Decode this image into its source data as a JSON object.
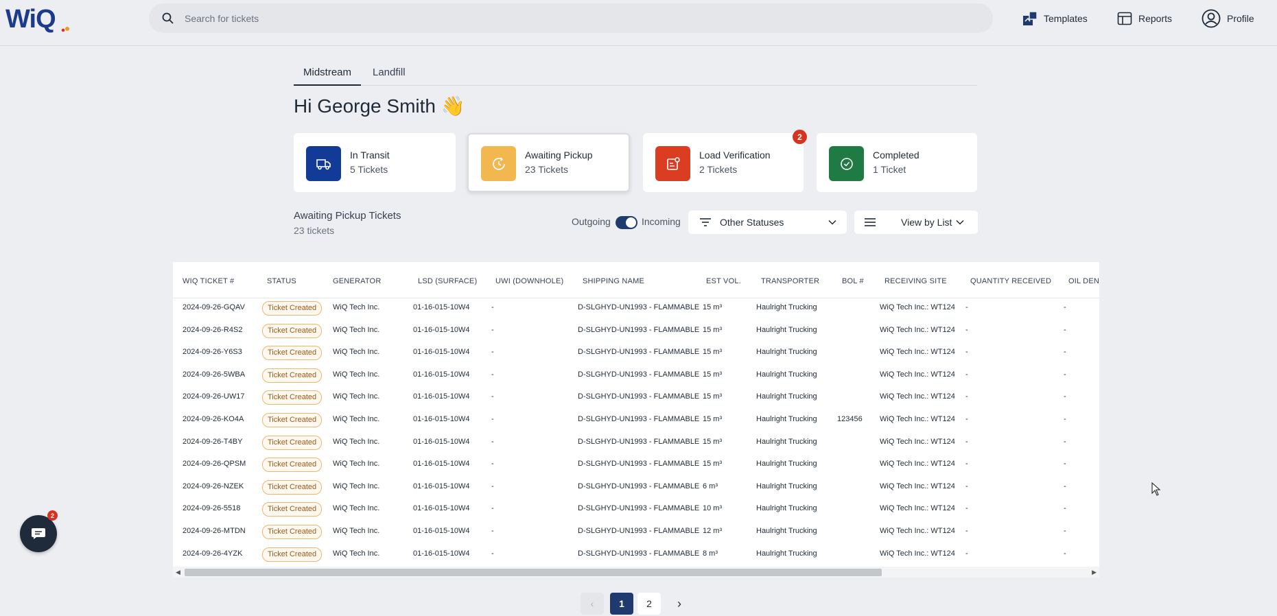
{
  "app": {
    "logo_text": "WiQ"
  },
  "header": {
    "search_placeholder": "Search for tickets",
    "nav": [
      {
        "label": "Templates",
        "icon": "templates-icon"
      },
      {
        "label": "Reports",
        "icon": "reports-icon"
      },
      {
        "label": "Profile",
        "icon": "profile-icon"
      }
    ]
  },
  "tabs": [
    {
      "label": "Midstream",
      "active": true
    },
    {
      "label": "Landfill",
      "active": false
    }
  ],
  "greeting": "Hi George Smith 👋",
  "cards": [
    {
      "title": "In Transit",
      "count": "5 Tickets",
      "color": "#123a97",
      "icon": "truck-icon"
    },
    {
      "title": "Awaiting Pickup",
      "count": "23 Tickets",
      "color": "#f2b74f",
      "icon": "clock-icon",
      "selected": true
    },
    {
      "title": "Load Verification",
      "count": "2 Tickets",
      "color": "#db3d22",
      "icon": "document-check-icon",
      "badge": "2"
    },
    {
      "title": "Completed",
      "count": "1 Ticket",
      "color": "#1f7a43",
      "icon": "check-circle-icon"
    }
  ],
  "section": {
    "title": "Awaiting Pickup Tickets",
    "subtitle": "23 tickets",
    "toggle_left": "Outgoing",
    "toggle_right": "Incoming",
    "status_filter": "Other Statuses",
    "view_mode": "View by List"
  },
  "table": {
    "columns": [
      "WIQ TICKET #",
      "STATUS",
      "GENERATOR",
      "LSD (SURFACE)",
      "UWI (DOWNHOLE)",
      "SHIPPING NAME",
      "EST VOL.",
      "TRANSPORTER",
      "BOL #",
      "RECEIVING SITE",
      "QUANTITY RECEIVED",
      "OIL DENS"
    ],
    "rows": [
      [
        "2024-09-26-GQAV",
        "Ticket Created",
        "WiQ Tech Inc.",
        "01-16-015-10W4",
        "-",
        "D-SLGHYD-UN1993 - FLAMMABLE",
        "15 m³",
        "Haulright Trucking",
        "",
        "WiQ Tech Inc.: WT124",
        "-",
        "-"
      ],
      [
        "2024-09-26-R4S2",
        "Ticket Created",
        "WiQ Tech Inc.",
        "01-16-015-10W4",
        "-",
        "D-SLGHYD-UN1993 - FLAMMABLE",
        "15 m³",
        "Haulright Trucking",
        "",
        "WiQ Tech Inc.: WT124",
        "-",
        "-"
      ],
      [
        "2024-09-26-Y6S3",
        "Ticket Created",
        "WiQ Tech Inc.",
        "01-16-015-10W4",
        "-",
        "D-SLGHYD-UN1993 - FLAMMABLE",
        "15 m³",
        "Haulright Trucking",
        "",
        "WiQ Tech Inc.: WT124",
        "-",
        "-"
      ],
      [
        "2024-09-26-5WBA",
        "Ticket Created",
        "WiQ Tech Inc.",
        "01-16-015-10W4",
        "-",
        "D-SLGHYD-UN1993 - FLAMMABLE",
        "15 m³",
        "Haulright Trucking",
        "",
        "WiQ Tech Inc.: WT124",
        "-",
        "-"
      ],
      [
        "2024-09-26-UW17",
        "Ticket Created",
        "WiQ Tech Inc.",
        "01-16-015-10W4",
        "-",
        "D-SLGHYD-UN1993 - FLAMMABLE",
        "15 m³",
        "Haulright Trucking",
        "",
        "WiQ Tech Inc.: WT124",
        "-",
        "-"
      ],
      [
        "2024-09-26-KO4A",
        "Ticket Created",
        "WiQ Tech Inc.",
        "01-16-015-10W4",
        "-",
        "D-SLGHYD-UN1993 - FLAMMABLE",
        "15 m³",
        "Haulright Trucking",
        "123456",
        "WiQ Tech Inc.: WT124",
        "-",
        "-"
      ],
      [
        "2024-09-26-T4BY",
        "Ticket Created",
        "WiQ Tech Inc.",
        "01-16-015-10W4",
        "-",
        "D-SLGHYD-UN1993 - FLAMMABLE",
        "15 m³",
        "Haulright Trucking",
        "",
        "WiQ Tech Inc.: WT124",
        "-",
        "-"
      ],
      [
        "2024-09-26-QPSM",
        "Ticket Created",
        "WiQ Tech Inc.",
        "01-16-015-10W4",
        "-",
        "D-SLGHYD-UN1993 - FLAMMABLE",
        "15 m³",
        "Haulright Trucking",
        "",
        "WiQ Tech Inc.: WT124",
        "-",
        "-"
      ],
      [
        "2024-09-26-NZEK",
        "Ticket Created",
        "WiQ Tech Inc.",
        "01-16-015-10W4",
        "-",
        "D-SLGHYD-UN1993 - FLAMMABLE",
        "6 m³",
        "Haulright Trucking",
        "",
        "WiQ Tech Inc.: WT124",
        "-",
        "-"
      ],
      [
        "2024-09-26-5518",
        "Ticket Created",
        "WiQ Tech Inc.",
        "01-16-015-10W4",
        "-",
        "D-SLGHYD-UN1993 - FLAMMABLE",
        "10 m³",
        "Haulright Trucking",
        "",
        "WiQ Tech Inc.: WT124",
        "-",
        "-"
      ],
      [
        "2024-09-26-MTDN",
        "Ticket Created",
        "WiQ Tech Inc.",
        "01-16-015-10W4",
        "-",
        "D-SLGHYD-UN1993 - FLAMMABLE",
        "12 m³",
        "Haulright Trucking",
        "",
        "WiQ Tech Inc.: WT124",
        "-",
        "-"
      ],
      [
        "2024-09-26-4YZK",
        "Ticket Created",
        "WiQ Tech Inc.",
        "01-16-015-10W4",
        "-",
        "D-SLGHYD-UN1993 - FLAMMABLE",
        "8 m³",
        "Haulright Trucking",
        "",
        "WiQ Tech Inc.: WT124",
        "-",
        "-"
      ]
    ]
  },
  "pagination": {
    "pages": [
      "1",
      "2"
    ],
    "current": "1",
    "prev": "‹",
    "next": "›"
  },
  "chat": {
    "badge": "2",
    "icon": "chat-icon"
  },
  "colors": {
    "primary": "#1e3a6e",
    "badge_red": "#d2341f",
    "status_pill": "#eab676"
  }
}
